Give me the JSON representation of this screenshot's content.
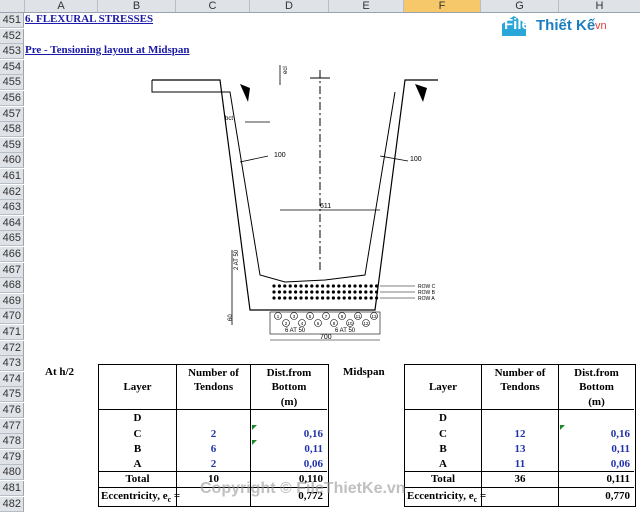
{
  "columns": [
    "A",
    "B",
    "C",
    "D",
    "E",
    "F",
    "G",
    "H"
  ],
  "selected_column": "F",
  "rows": [
    "451",
    "452",
    "453",
    "454",
    "455",
    "456",
    "457",
    "458",
    "459",
    "460",
    "461",
    "462",
    "463",
    "464",
    "465",
    "466",
    "467",
    "468",
    "469",
    "470",
    "471",
    "472",
    "473",
    "474",
    "475",
    "476",
    "477",
    "478",
    "479",
    "480",
    "481",
    "482"
  ],
  "section_title": "6. FLEXURAL STRESSES",
  "subtitle": "Pre - Tensioning layout at Midspan",
  "drawing": {
    "ecl_label": "ecl",
    "bct_label": "bct",
    "wall_left": "100",
    "wall_right": "100",
    "width_top": "611",
    "spacing_vert": "2 AT 50",
    "bottom_offset": "60",
    "row_c": "ROW C",
    "row_b": "ROW B",
    "row_a": "ROW A",
    "spacing_left": "6 AT 50",
    "spacing_right": "6 AT 50",
    "bottom_width": "700",
    "circle_labels": [
      "1",
      "3",
      "5",
      "7",
      "9",
      "11",
      "13",
      "2",
      "4",
      "6",
      "8",
      "10",
      "12"
    ]
  },
  "left_table": {
    "label": "At h/2",
    "header_layer": "Layer",
    "header_tendons_1": "Number of",
    "header_tendons_2": "Tendons",
    "header_dist_1": "Dist.from",
    "header_dist_2": "Bottom",
    "header_dist_3": "(m)",
    "rows": [
      {
        "layer": "D",
        "tendons": "",
        "dist": ""
      },
      {
        "layer": "C",
        "tendons": "2",
        "dist": "0,16"
      },
      {
        "layer": "B",
        "tendons": "6",
        "dist": "0,11"
      },
      {
        "layer": "A",
        "tendons": "2",
        "dist": "0,06"
      },
      {
        "layer": "Total",
        "tendons": "10",
        "dist": "0,110"
      }
    ],
    "ecc_label": "Eccentricity, e",
    "ecc_sub": "c",
    "ecc_eq": " =",
    "ecc_value": "0,772"
  },
  "right_table": {
    "label": "Midspan",
    "header_layer": "Layer",
    "header_tendons_1": "Number of",
    "header_tendons_2": "Tendons",
    "header_dist_1": "Dist.from",
    "header_dist_2": "Bottom",
    "header_dist_3": "(m)",
    "rows": [
      {
        "layer": "D",
        "tendons": "",
        "dist": ""
      },
      {
        "layer": "C",
        "tendons": "12",
        "dist": "0,16"
      },
      {
        "layer": "B",
        "tendons": "13",
        "dist": "0,11"
      },
      {
        "layer": "A",
        "tendons": "11",
        "dist": "0,06"
      },
      {
        "layer": "Total",
        "tendons": "36",
        "dist": "0,111"
      }
    ],
    "ecc_label": "Eccentricity, e",
    "ecc_sub": "c",
    "ecc_eq": " =",
    "ecc_value": "0,770"
  },
  "logo": {
    "part1": "File",
    "part2": "Thiết Kế",
    "part3": ".vn"
  },
  "watermark": "Copyright © FileThietKe.vn"
}
